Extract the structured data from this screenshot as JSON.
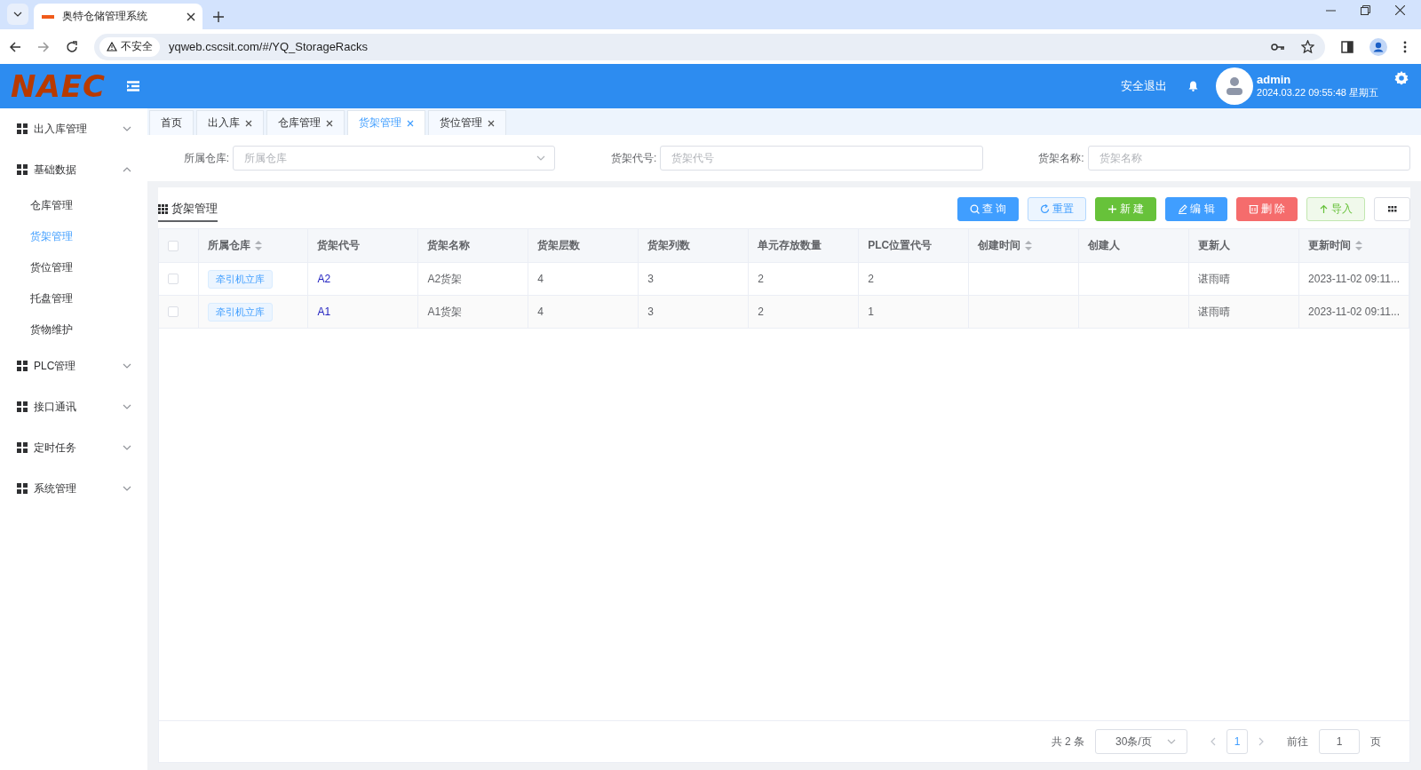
{
  "browser": {
    "tab_title": "奥特仓储管理系统",
    "security_label": "不安全",
    "url": "yqweb.cscsit.com/#/YQ_StorageRacks"
  },
  "header": {
    "logo": "NAEC",
    "logout": "安全退出",
    "user": {
      "name": "admin",
      "datetime": "2024.03.22 09:55:48 星期五"
    }
  },
  "sidebar": {
    "items": [
      {
        "label": "出入库管理",
        "expanded": false
      },
      {
        "label": "基础数据",
        "expanded": true,
        "children": [
          {
            "label": "仓库管理",
            "selected": false
          },
          {
            "label": "货架管理",
            "selected": true
          },
          {
            "label": "货位管理",
            "selected": false
          },
          {
            "label": "托盘管理",
            "selected": false
          },
          {
            "label": "货物维护",
            "selected": false
          }
        ]
      },
      {
        "label": "PLC管理",
        "expanded": false
      },
      {
        "label": "接口通讯",
        "expanded": false
      },
      {
        "label": "定时任务",
        "expanded": false
      },
      {
        "label": "系统管理",
        "expanded": false
      }
    ]
  },
  "tabs": [
    {
      "label": "首页",
      "selected": false,
      "closable": false
    },
    {
      "label": "出入库",
      "selected": false,
      "closable": true
    },
    {
      "label": "仓库管理",
      "selected": false,
      "closable": true
    },
    {
      "label": "货架管理",
      "selected": true,
      "closable": true
    },
    {
      "label": "货位管理",
      "selected": false,
      "closable": true
    }
  ],
  "filters": [
    {
      "kind": "select",
      "label": "所属仓库:",
      "placeholder": "所属仓库"
    },
    {
      "kind": "text",
      "label": "货架代号:",
      "placeholder": "货架代号"
    },
    {
      "kind": "text",
      "label": "货架名称:",
      "placeholder": "货架名称"
    }
  ],
  "section_title": "货架管理",
  "toolbar": [
    {
      "kind": "query",
      "label": "查 询"
    },
    {
      "kind": "reset",
      "label": "重置"
    },
    {
      "kind": "create",
      "label": "新 建"
    },
    {
      "kind": "edit",
      "label": "编 辑"
    },
    {
      "kind": "delete",
      "label": "删 除"
    },
    {
      "kind": "import",
      "label": "导入"
    },
    {
      "kind": "columns"
    }
  ],
  "table": {
    "header_checked": false,
    "columns": [
      {
        "label": "所属仓库",
        "sortable": true
      },
      {
        "label": "货架代号",
        "sortable": false
      },
      {
        "label": "货架名称",
        "sortable": false
      },
      {
        "label": "货架层数",
        "sortable": false
      },
      {
        "label": "货架列数",
        "sortable": false
      },
      {
        "label": "单元存放数量",
        "sortable": false
      },
      {
        "label": "PLC位置代号",
        "sortable": false
      },
      {
        "label": "创建时间",
        "sortable": true
      },
      {
        "label": "创建人",
        "sortable": false
      },
      {
        "label": "更新人",
        "sortable": false
      },
      {
        "label": "更新时间",
        "sortable": true
      }
    ],
    "rows": [
      {
        "selected": false,
        "warehouse": "牵引机立库",
        "code": "A2",
        "name": "A2货架",
        "levels": "4",
        "columns": "3",
        "unit_qty": "2",
        "plc_code": "2",
        "updater": "谌雨晴",
        "updated": "2023-11-02 09:11..."
      },
      {
        "selected": false,
        "warehouse": "牵引机立库",
        "code": "A1",
        "name": "A1货架",
        "levels": "4",
        "columns": "3",
        "unit_qty": "2",
        "plc_code": "1",
        "updater": "谌雨晴",
        "updated": "2023-11-02 09:11..."
      }
    ]
  },
  "pagination": {
    "total": "共 2 条",
    "page_size": "30条/页",
    "pages": [
      {
        "label": "1",
        "selected": true
      }
    ],
    "goto_label": "前往",
    "goto_value": "1",
    "page_unit": "页"
  }
}
